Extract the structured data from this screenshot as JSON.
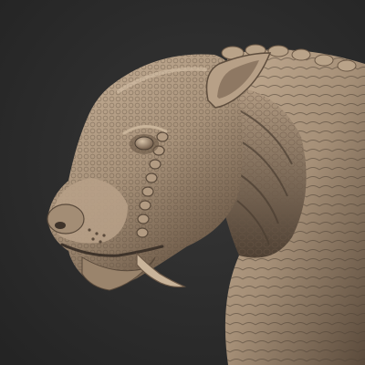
{
  "scene": {
    "subject": "sculpted-creature-bust",
    "background_color": "#2b2b2b",
    "material_color": "#a58f77",
    "material_highlight": "#c4ad93",
    "material_shadow": "#5a4a3b",
    "tusk_color": "#c9b49a"
  }
}
